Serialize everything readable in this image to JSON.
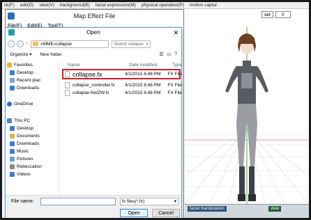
{
  "main_menu": [
    "ile(F)",
    "edit(D)",
    "view(V)",
    "background(B)",
    "facial expression(M)",
    "physical operation(P)",
    "motion captur"
  ],
  "top_right": {
    "set_label": "set",
    "value": "0"
  },
  "right_panel": {
    "facial_manipulation": "facial manipulation",
    "view": "view"
  },
  "map_effect_dialog": {
    "title": "Map Effect File",
    "menu": [
      "File(F)",
      "Edit(E)",
      "Tool(T)"
    ]
  },
  "open_dialog": {
    "title": "Open",
    "path": [
      "MME",
      "collapse"
    ],
    "search_placeholder": "Search collapse",
    "organize_label": "Organize",
    "new_folder_label": "New folder",
    "nav": {
      "favorites": "Favorites",
      "fav_items": [
        "Desktop",
        "Recent plac",
        "Downloads"
      ],
      "onedrive": "OneDrive",
      "this_pc": "This PC",
      "pc_items": [
        "Desktop",
        "Documents",
        "Downloads",
        "Music",
        "Pictures",
        "Rebeccalion",
        "Videos"
      ]
    },
    "columns": {
      "name": "Name",
      "date": "Date modified",
      "type": "Type"
    },
    "files": [
      {
        "name": "collapse.fx",
        "date": "4/1/2015 6:48 PM",
        "type": "FX File"
      },
      {
        "name": "collapse_controller.fx",
        "date": "4/1/2015 6:48 PM",
        "type": "FX File"
      },
      {
        "name": "collapse-NotZW.fx",
        "date": "4/1/2015 6:48 PM",
        "type": "FX File"
      }
    ],
    "file_name_label": "File name:",
    "file_name_value": "",
    "file_type": "fx files(*.fx)",
    "open_label": "Open",
    "cancel_label": "Cancel"
  }
}
